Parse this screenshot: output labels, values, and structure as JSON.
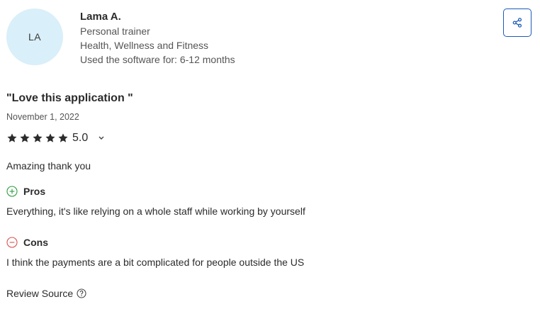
{
  "reviewer": {
    "initials": "LA",
    "name": "Lama A.",
    "role": "Personal trainer",
    "industry": "Health, Wellness and Fitness",
    "usage": "Used the software for: 6-12 months"
  },
  "actions": {
    "share_icon": "share-icon"
  },
  "review": {
    "title": "\"Love this application \"",
    "date": "November 1, 2022",
    "rating": "5.0",
    "stars": 5,
    "summary": "Amazing thank you",
    "pros_label": "Pros",
    "pros": "Everything, it's like relying on a whole staff while working by yourself",
    "cons_label": "Cons",
    "cons": "I think the payments are a bit complicated for people outside the US",
    "source_label": "Review Source"
  },
  "colors": {
    "avatar_bg": "#d9eff9",
    "share_border": "#1a5bb8",
    "pros_green": "#2e9b3f",
    "cons_red": "#d9534f",
    "star": "#2b2b2b"
  }
}
